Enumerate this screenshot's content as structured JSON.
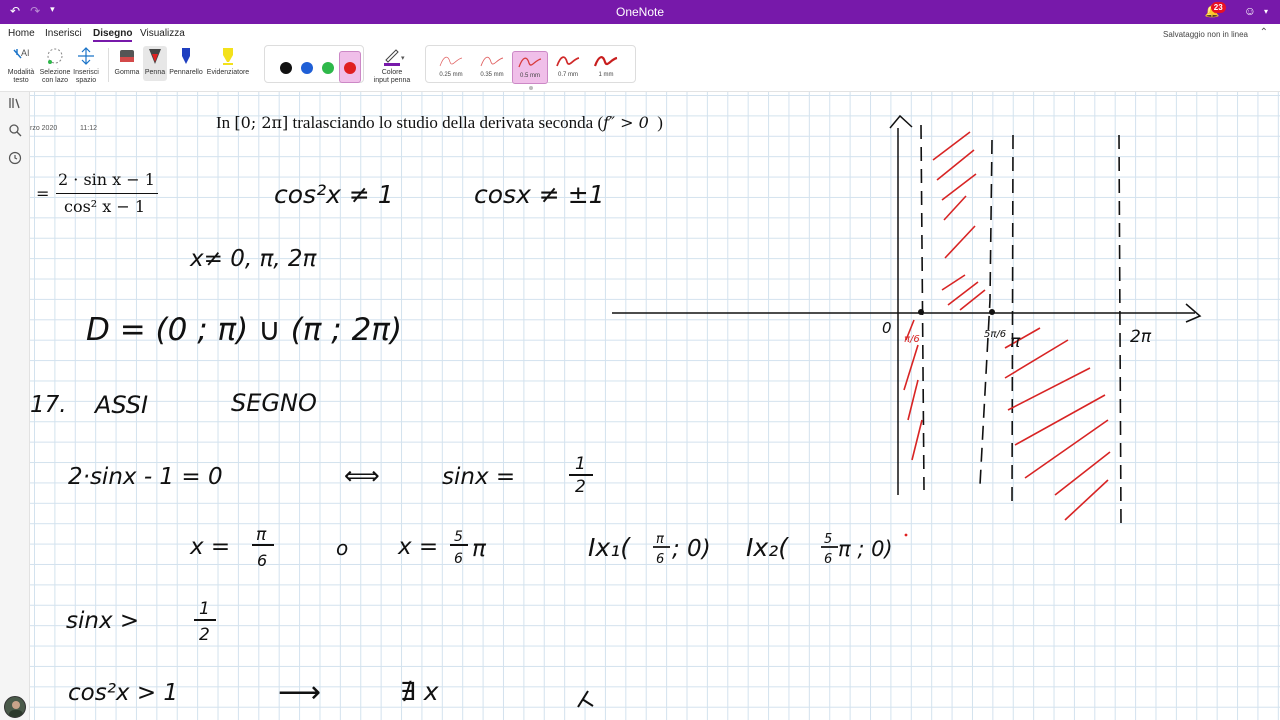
{
  "app": {
    "title": "OneNote",
    "notifications": "23",
    "save_status": "Salvataggio non in linea"
  },
  "menu": {
    "tabs": [
      "Home",
      "Inserisci",
      "Disegno",
      "Visualizza"
    ],
    "active": "Disegno"
  },
  "ribbon": {
    "tools": {
      "text_mode": [
        "Modalità",
        "testo"
      ],
      "lasso": [
        "Selezione",
        "con lazo"
      ],
      "insert_space": [
        "Inserisci",
        "spazio"
      ],
      "eraser": "Gomma",
      "pen": "Penna",
      "marker": "Pennarello",
      "highlighter": "Evidenziatore",
      "pen_color": [
        "Colore",
        "input penna"
      ]
    },
    "colors": [
      "#111111",
      "#1f5fd6",
      "#2eb84a",
      "#e02020"
    ],
    "selected_color": "#e02020",
    "thicknesses": [
      "0.25 mm",
      "0.35 mm",
      "0.5 mm",
      "0.7 mm",
      "1 mm"
    ],
    "selected_thickness": "0.5 mm"
  },
  "page": {
    "date": "rzo 2020",
    "time": "11:12",
    "typed_intro": "In",
    "typed_interval": "[0; 2π]",
    "typed_text": "tralasciando lo studio della derivata seconda (",
    "typed_fpp": "f″ > 0",
    "typed_close": ")",
    "formula_lhs": "=",
    "formula_num": "2 · sin x − 1",
    "formula_den": "cos² x − 1"
  },
  "ink": {
    "cond1": "cos²x ≠ 1",
    "cond2": "cosx ≠ ±1",
    "excluded": "x≠ 0, π, 2π",
    "domain": "D = (0 ; π) ∪ (π ; 2π)",
    "heading_num": "17.",
    "heading_assi": "ASSI",
    "heading_segno": "SEGNO",
    "eq1_lhs": "2·sinx - 1 = 0",
    "eq1_arrow": "⟺",
    "eq1_rhs": "sinx =",
    "frac_half_num": "1",
    "frac_half_den": "2",
    "sol_x1": "x =",
    "sol_pi": "π",
    "sol_6": "6",
    "sol_or": "o",
    "sol_x2": "x =",
    "sol_5": "5",
    "sol_5pi": "π",
    "int1": "Ix₁(",
    "int1_num": "π",
    "int1_den": "6",
    "int1_end": "; 0)",
    "int2": "Ix₂(",
    "int2_num": "5",
    "int2_den": "6",
    "int2_end": "π ; 0)",
    "ineq1": "sinx >",
    "ineq2": "cos²x > 1",
    "ineq2_arrow": "⟶",
    "ineq2_rhs": "∄ x",
    "graph_0": "0",
    "graph_pi6": "π/6",
    "graph_5pi6": "5π/6",
    "graph_pi": "π",
    "graph_2pi": "2π"
  }
}
